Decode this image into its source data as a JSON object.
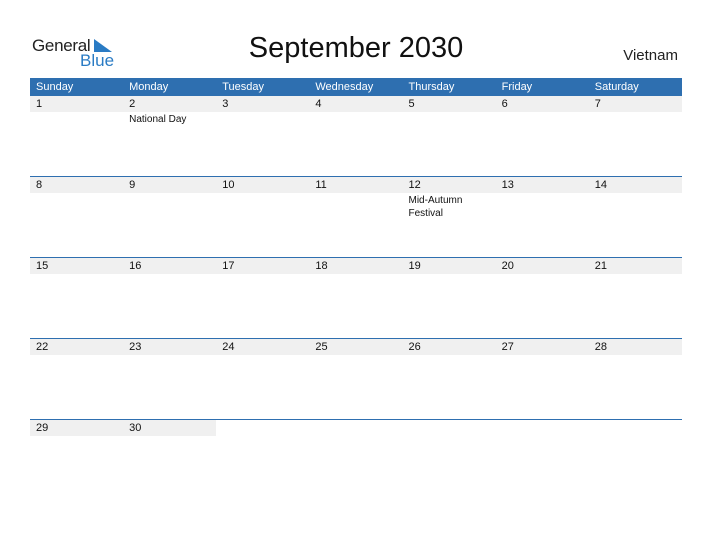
{
  "logo": {
    "general": "General",
    "blue": "Blue"
  },
  "title": "September 2030",
  "country": "Vietnam",
  "colors": {
    "header_bg": "#2e6fb0",
    "date_bg": "#f0f0f0",
    "logo_blue": "#2a7bc4"
  },
  "weekdays": [
    "Sunday",
    "Monday",
    "Tuesday",
    "Wednesday",
    "Thursday",
    "Friday",
    "Saturday"
  ],
  "weeks": [
    {
      "days": [
        {
          "date": "1",
          "event": ""
        },
        {
          "date": "2",
          "event": "National Day"
        },
        {
          "date": "3",
          "event": ""
        },
        {
          "date": "4",
          "event": ""
        },
        {
          "date": "5",
          "event": ""
        },
        {
          "date": "6",
          "event": ""
        },
        {
          "date": "7",
          "event": ""
        }
      ]
    },
    {
      "days": [
        {
          "date": "8",
          "event": ""
        },
        {
          "date": "9",
          "event": ""
        },
        {
          "date": "10",
          "event": ""
        },
        {
          "date": "11",
          "event": ""
        },
        {
          "date": "12",
          "event": "Mid-Autumn Festival"
        },
        {
          "date": "13",
          "event": ""
        },
        {
          "date": "14",
          "event": ""
        }
      ]
    },
    {
      "days": [
        {
          "date": "15",
          "event": ""
        },
        {
          "date": "16",
          "event": ""
        },
        {
          "date": "17",
          "event": ""
        },
        {
          "date": "18",
          "event": ""
        },
        {
          "date": "19",
          "event": ""
        },
        {
          "date": "20",
          "event": ""
        },
        {
          "date": "21",
          "event": ""
        }
      ]
    },
    {
      "days": [
        {
          "date": "22",
          "event": ""
        },
        {
          "date": "23",
          "event": ""
        },
        {
          "date": "24",
          "event": ""
        },
        {
          "date": "25",
          "event": ""
        },
        {
          "date": "26",
          "event": ""
        },
        {
          "date": "27",
          "event": ""
        },
        {
          "date": "28",
          "event": ""
        }
      ]
    },
    {
      "days": [
        {
          "date": "29",
          "event": ""
        },
        {
          "date": "30",
          "event": ""
        },
        {
          "date": "",
          "event": ""
        },
        {
          "date": "",
          "event": ""
        },
        {
          "date": "",
          "event": ""
        },
        {
          "date": "",
          "event": ""
        },
        {
          "date": "",
          "event": ""
        }
      ]
    }
  ]
}
